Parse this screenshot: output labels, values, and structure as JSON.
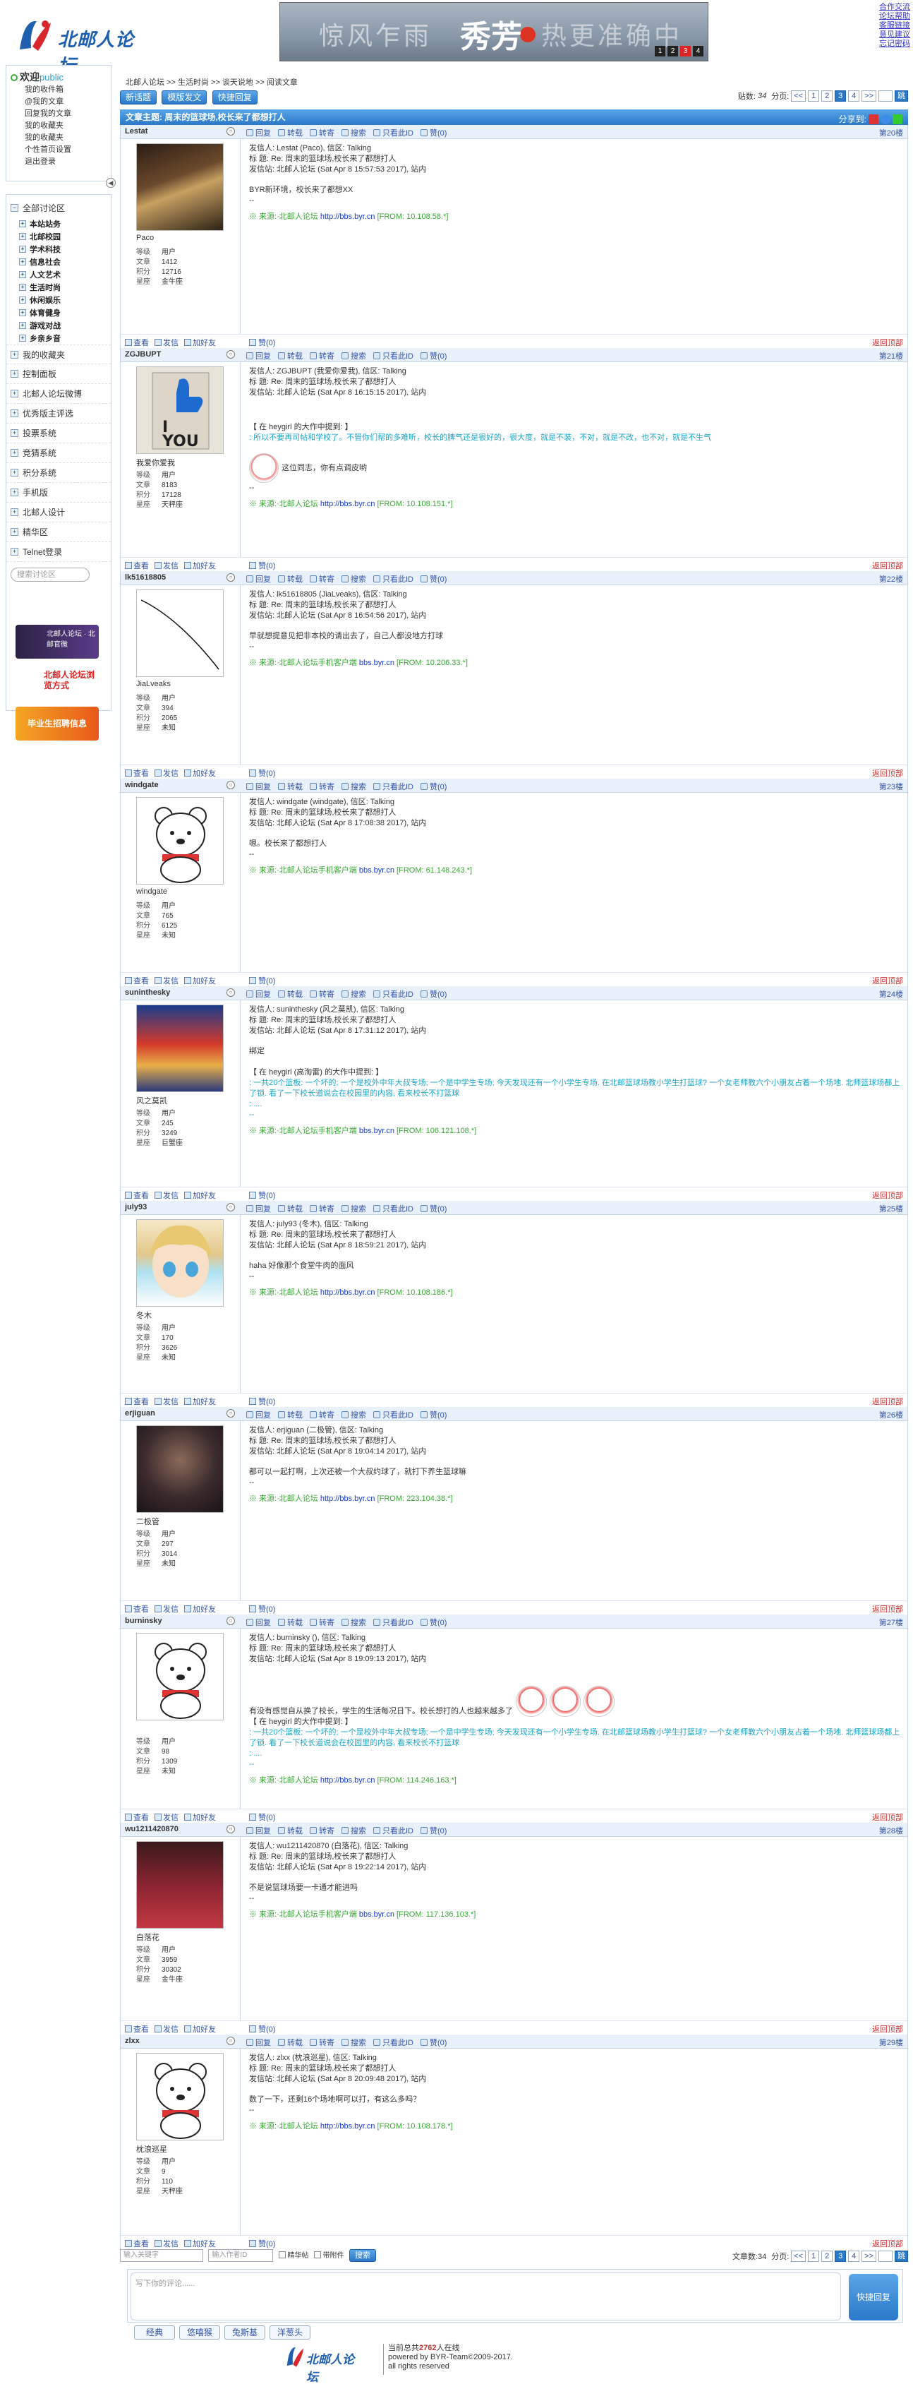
{
  "header": {
    "logo_text": "北邮人论坛",
    "banner": {
      "text_left": "惊风乍雨",
      "text_main": "秀芳",
      "text_right": "热更准确中",
      "slides": [
        "1",
        "2",
        "3",
        "4"
      ],
      "active_slide": 2
    },
    "links": [
      "合作交流",
      "论坛帮助",
      "客服链接",
      "意见建议",
      "忘记密码"
    ]
  },
  "sidebar": {
    "welcome_label": "欢迎",
    "username": "public",
    "links": [
      "我的收件箱",
      "@我的文章",
      "回复我的文章",
      "我的收藏夹",
      "我的收藏夹",
      "个性首页设置",
      "退出登录"
    ],
    "all_boards_label": "全部讨论区",
    "sub_boards": [
      "本站站务",
      "北邮校园",
      "学术科技",
      "信息社会",
      "人文艺术",
      "生活时尚",
      "休闲娱乐",
      "体育健身",
      "游戏对战",
      "乡亲乡音"
    ],
    "menu": [
      "我的收藏夹",
      "控制面板",
      "北邮人论坛微博",
      "优秀版主评选",
      "投票系统",
      "竞猜系统",
      "积分系统",
      "手机版",
      "北邮人设计",
      "精华区",
      "Telnet登录"
    ],
    "search_placeholder": "搜索讨论区",
    "ads": [
      "北邮人论坛 · 北邮官微",
      "北邮人论坛浏览方式",
      "毕业生招聘信息"
    ]
  },
  "breadcrumb": "北邮人论坛 >> 生活时尚 >> 谈天说地 >> 阅读文章",
  "toolbar": {
    "buttons": [
      "新话题",
      "模版发文",
      "快捷回复"
    ],
    "post_count_label": "贴数:",
    "post_count": "34",
    "page_label": "分页:",
    "pages": [
      "<<",
      "1",
      "2",
      "3",
      "4",
      ">>"
    ],
    "current_page": "3",
    "go": "跳"
  },
  "topic": {
    "label": "文章主题:",
    "title": "周末的篮球场,校长来了都想打人",
    "share_label": "分享到:"
  },
  "post_actions": [
    "回复",
    "转载",
    "转寄",
    "搜索",
    "只看此ID",
    "赞(0)"
  ],
  "footer_actions": [
    "查看",
    "发信",
    "加好友"
  ],
  "back_top": "返回顶部",
  "stat_keys": [
    "等级",
    "文章",
    "积分",
    "星座"
  ],
  "posts": [
    {
      "user": "Lestat",
      "nick": "Paco",
      "floor": "第20楼",
      "level": "用户",
      "articles": "1412",
      "score": "12716",
      "star": "金牛座",
      "h1": "发信人: Lestat (Paco), 信区: Talking",
      "h2": "标  题: Re: 周末的篮球场,校长来了都想打人",
      "h3": "发信站: 北邮人论坛 (Sat Apr  8 15:57:53 2017), 站内",
      "body": [
        "BYR新环境，校长来了都想XX",
        "--"
      ],
      "quote": [],
      "src_a": "※ 来源:·北邮人论坛 ",
      "src_b": "http://bbs.byr.cn",
      "src_c": " [FROM: 10.108.58.*]"
    },
    {
      "user": "ZGJBUPT",
      "nick": "我爱你爱我",
      "floor": "第21楼",
      "level": "用户",
      "articles": "8183",
      "score": "17128",
      "star": "天秤座",
      "h1": "发信人: ZGJBUPT (我爱你爱我), 信区: Talking",
      "h2": "标  题: Re: 周末的篮球场,校长来了都想打人",
      "h3": "发信站: 北邮人论坛 (Sat Apr  8 16:15:15 2017), 站内",
      "body": [],
      "quote": [
        "【 在 heygirl 的大作中提到: 】",
        ": 所以不要再司帖和学校了。不管你们帮的多难听，校长的脾气还是很好的，很大度，就是不装，不对，就是不改，也不对，就是不生气"
      ],
      "after": [
        "这位同志，你有点调皮哟",
        "--"
      ],
      "src_a": "※ 来源:·北邮人论坛 ",
      "src_b": "http://bbs.byr.cn",
      "src_c": " [FROM: 10.108.151.*]"
    },
    {
      "user": "lk51618805",
      "nick": "JiaLveaks",
      "floor": "第22楼",
      "level": "用户",
      "articles": "394",
      "score": "2065",
      "star": "未知",
      "h1": "发信人: lk51618805 (JiaLveaks), 信区: Talking",
      "h2": "标  题: Re: 周末的篮球场,校长来了都想打人",
      "h3": "发信站: 北邮人论坛 (Sat Apr  8 16:54:56 2017), 站内",
      "body": [
        "早就想提意见把非本校的请出去了，自己人都没地方打球",
        "--"
      ],
      "quote": [],
      "src_a": "※ 来源:·北邮人论坛手机客户端 ",
      "src_b": "bbs.byr.cn",
      "src_c": " [FROM: 10.206.33.*]"
    },
    {
      "user": "windgate",
      "nick": "windgate",
      "floor": "第23楼",
      "level": "用户",
      "articles": "765",
      "score": "6125",
      "star": "未知",
      "h1": "发信人: windgate (windgate), 信区: Talking",
      "h2": "标  题: Re: 周末的篮球场,校长来了都想打人",
      "h3": "发信站: 北邮人论坛 (Sat Apr  8 17:08:38 2017), 站内",
      "body": [
        "嗯。校长来了都想打人",
        "--"
      ],
      "quote": [],
      "src_a": "※ 来源:·北邮人论坛手机客户端 ",
      "src_b": "bbs.byr.cn",
      "src_c": " [FROM: 61.148.243.*]"
    },
    {
      "user": "suninthesky",
      "nick": "风之莫凯",
      "floor": "第24楼",
      "level": "用户",
      "articles": "245",
      "score": "3249",
      "star": "巨蟹座",
      "h1": "发信人: suninthesky (风之莫凯), 信区: Talking",
      "h2": "标  题: Re: 周末的篮球场,校长来了都想打人",
      "h3": "发信站: 北邮人论坛 (Sat Apr  8 17:31:12 2017), 站内",
      "body": [
        "绑定"
      ],
      "quote": [
        "【 在 heygirl (高淘雷) 的大作中提到: 】",
        ": 一共20个篮板: 一个坏的; 一个是校外中年大叔专场; 一个是中学生专场; 今天发现还有一个小学生专场. 在北邮篮球场教小学生打篮球? 一个女老师教六个小朋友占着一个场地. 北师篮球场都上了锁. 看了一下校长道说会在校园里的内容, 看来校长不打篮球",
        ": ....",
        "--"
      ],
      "after": [],
      "src_a": "※ 来源:·北邮人论坛手机客户端 ",
      "src_b": "bbs.byr.cn",
      "src_c": " [FROM: 106.121.108.*]"
    },
    {
      "user": "july93",
      "nick": "冬木",
      "floor": "第25楼",
      "level": "用户",
      "articles": "170",
      "score": "3626",
      "star": "未知",
      "h1": "发信人: july93 (冬木), 信区: Talking",
      "h2": "标  题: Re: 周末的篮球场,校长来了都想打人",
      "h3": "发信站: 北邮人论坛 (Sat Apr  8 18:59:21 2017), 站内",
      "body": [
        "haha 好像那个食堂牛肉的面风",
        "--"
      ],
      "quote": [],
      "src_a": "※ 来源:·北邮人论坛 ",
      "src_b": "http://bbs.byr.cn",
      "src_c": " [FROM: 10.108.186.*]"
    },
    {
      "user": "erjiguan",
      "nick": "二极管",
      "floor": "第26楼",
      "level": "用户",
      "articles": "297",
      "score": "3014",
      "star": "未知",
      "h1": "发信人: erjiguan (二极管), 信区: Talking",
      "h2": "标  题: Re: 周末的篮球场,校长来了都想打人",
      "h3": "发信站: 北邮人论坛 (Sat Apr  8 19:04:14 2017), 站内",
      "body": [
        "都可以一起打啊，上次还被一个大叔约球了，就打下养生篮球嘛",
        "--"
      ],
      "quote": [],
      "src_a": "※ 来源:·北邮人论坛 ",
      "src_b": "http://bbs.byr.cn",
      "src_c": " [FROM: 223.104.38.*]"
    },
    {
      "user": "burninsky",
      "nick": "",
      "floor": "第27楼",
      "level": "用户",
      "articles": "98",
      "score": "1309",
      "star": "未知",
      "h1": "发信人: burninsky (), 信区: Talking",
      "h2": "标  题: Re: 周末的篮球场,校长来了都想打人",
      "h3": "发信站: 北邮人论坛 (Sat Apr  8 19:09:13 2017), 站内",
      "body": [
        "有没有感觉自从换了校长，学生的生活每况日下。校长想打的人也越来越多了"
      ],
      "quote": [
        "【 在 heygirl 的大作中提到: 】",
        ": 一共20个篮板: 一个坏的; 一个是校外中年大叔专场; 一个是中学生专场; 今天发现还有一个小学生专场. 在北邮篮球场教小学生打篮球? 一个女老师教六个小朋友占着一个场地. 北师篮球场都上了锁. 看了一下校长道说会在校园里的内容, 看来校长不打篮球",
        ": ....",
        "--"
      ],
      "after": [],
      "src_a": "※ 来源:·北邮人论坛 ",
      "src_b": "http://bbs.byr.cn",
      "src_c": " [FROM: 114.246.163.*]"
    },
    {
      "user": "wu1211420870",
      "nick": "白落花",
      "floor": "第28楼",
      "level": "用户",
      "articles": "3959",
      "score": "30302",
      "star": "金牛座",
      "h1": "发信人: wu1211420870 (白落花), 信区: Talking",
      "h2": "标  题: Re: 周末的篮球场,校长来了都想打人",
      "h3": "发信站: 北邮人论坛 (Sat Apr  8 19:22:14 2017), 站内",
      "body": [
        "不是说篮球场要一卡通才能进吗",
        "--"
      ],
      "quote": [],
      "src_a": "※ 来源:·北邮人论坛手机客户端 ",
      "src_b": "bbs.byr.cn",
      "src_c": " [FROM: 117.136.103.*]"
    },
    {
      "user": "zlxx",
      "nick": "枕浪巡星",
      "floor": "第29楼",
      "level": "用户",
      "articles": "9",
      "score": "110",
      "star": "天秤座",
      "h1": "发信人: zlxx (枕浪巡星), 信区: Talking",
      "h2": "标  题: Re: 周末的篮球场,校长来了都想打人",
      "h3": "发信站: 北邮人论坛 (Sat Apr  8 20:09:48 2017), 站内",
      "body": [
        "数了一下，还剩16个场地啊可以打，有这么多吗？",
        "--"
      ],
      "quote": [],
      "src_a": "※ 来源:·北邮人论坛 ",
      "src_b": "http://bbs.byr.cn",
      "src_c": " [FROM: 10.108.178.*]"
    }
  ],
  "bottom": {
    "keyword_placeholder": "输入关键字",
    "author_placeholder": "输入作者ID",
    "checkbox_elite": "精华帖",
    "checkbox_attach": "带附件",
    "search_btn": "搜索",
    "post_count_label": "文章数:34",
    "page_label": "分页:"
  },
  "reply": {
    "placeholder": "写下你的评论......",
    "send": "快捷回复",
    "emoticons": [
      "经典",
      "悠嘻猴",
      "兔斯基",
      "洋葱头"
    ]
  },
  "footer": {
    "logo": "北邮人论坛",
    "online_prefix": "当前总共",
    "online_count": "2762",
    "online_suffix": "人在线",
    "powered": "powered by BYR-Team©2009-2017.",
    "rights": "all rights reserved"
  }
}
